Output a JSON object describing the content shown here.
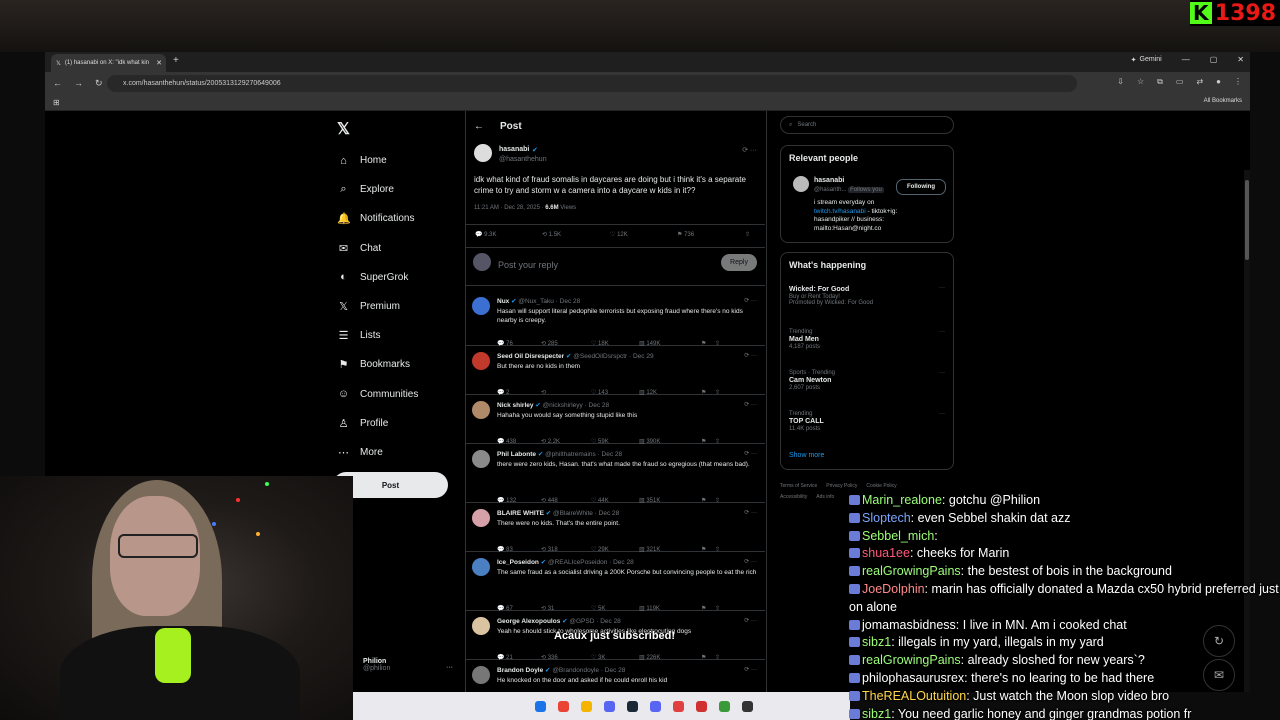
{
  "overlay": {
    "kick_logo": "K",
    "kick_count": "1398"
  },
  "browser": {
    "tab_title": "(1) hasanabi on X: \"idk what kin",
    "url": "x.com/hasanthehun/status/2005313129270649006",
    "gemini": "Gemini",
    "all_bookmarks": "All Bookmarks"
  },
  "x": {
    "nav": [
      {
        "label": "Home",
        "icon": "home-icon",
        "glyph": "⌂"
      },
      {
        "label": "Explore",
        "icon": "search-icon",
        "glyph": "⌕"
      },
      {
        "label": "Notifications",
        "icon": "bell-icon",
        "glyph": "🔔"
      },
      {
        "label": "Chat",
        "icon": "chat-icon",
        "glyph": "✉"
      },
      {
        "label": "SuperGrok",
        "icon": "grok-icon",
        "glyph": "◐"
      },
      {
        "label": "Premium",
        "icon": "x-logo-icon",
        "glyph": "𝕏"
      },
      {
        "label": "Lists",
        "icon": "list-icon",
        "glyph": "☰"
      },
      {
        "label": "Bookmarks",
        "icon": "bookmark-icon",
        "glyph": "⚑"
      },
      {
        "label": "Communities",
        "icon": "people-icon",
        "glyph": "☺"
      },
      {
        "label": "Profile",
        "icon": "person-icon",
        "glyph": "♙"
      },
      {
        "label": "More",
        "icon": "more-icon",
        "glyph": "⋯"
      }
    ],
    "post_button": "Post",
    "account": {
      "name": "Philion",
      "handle": "@philion"
    },
    "header": {
      "back": "←",
      "title": "Post"
    },
    "main_post": {
      "name": "hasanabi",
      "handle": "@hasanthehun",
      "text": "idk what kind of fraud somalis in daycares are doing but i think it's a separate crime to try and storm w a camera into a daycare w kids in it??",
      "time": "11:21 AM · Dec 28, 2025 · ",
      "views_num": "6.6M",
      "views_label": " Views",
      "replies": "9.3K",
      "reposts": "1.5K",
      "likes": "12K",
      "bookmarks": "736"
    },
    "reply_box": {
      "placeholder": "Post your reply",
      "button": "Reply"
    },
    "replies": [
      {
        "name": "Nux",
        "meta": "@Nux_Taku · Dec 28",
        "text": "Hasan will support literal pedophile terrorists but exposing fraud where there's no kids nearby is creepy.",
        "r": "76",
        "rt": "285",
        "l": "18K",
        "v": "149K",
        "color": "#3b6fd1"
      },
      {
        "name": "Seed Oil Disrespecter",
        "meta": "@SeedOilDsrspctr · Dec 29",
        "text": "But there are no kids in them",
        "r": "2",
        "rt": "",
        "l": "143",
        "v": "12K",
        "color": "#c0392b"
      },
      {
        "name": "Nick shirley",
        "meta": "@nickshirleyy · Dec 28",
        "text": "Hahaha you would say something stupid like this",
        "r": "438",
        "rt": "2.2K",
        "l": "59K",
        "v": "390K",
        "color": "#b08968"
      },
      {
        "name": "Phil Labonte",
        "meta": "@philthatremains · Dec 28",
        "text": "there were zero kids, Hasan. that's what made the fraud so egregious (that means bad).",
        "r": "132",
        "rt": "448",
        "l": "44K",
        "v": "351K",
        "color": "#8a8a8a"
      },
      {
        "name": "BLAIRE WHITE",
        "meta": "@BlaireWhite · Dec 28",
        "text": "There were no kids. That's the entire point.",
        "r": "83",
        "rt": "318",
        "l": "29K",
        "v": "321K",
        "color": "#d6a0a8"
      },
      {
        "name": "Ice_Poseidon",
        "meta": "@REALIcePoseidon · Dec 28",
        "text": "The same fraud as a socialist driving a 200K Porsche but convincing people to eat the rich",
        "r": "67",
        "rt": "31",
        "l": "5K",
        "v": "119K",
        "color": "#4a7fc1"
      },
      {
        "name": "George Alexopoulos",
        "meta": "@GPSD · Dec 28",
        "text": "Yeah he should stick to wholesome activities like electrocuting dogs",
        "r": "21",
        "rt": "336",
        "l": "3K",
        "v": "226K",
        "color": "#d9c3a0"
      },
      {
        "name": "Brandon Doyle",
        "meta": "@Brandondoyle · Dec 28",
        "text": "He knocked on the door and asked if he could enroll his kid",
        "r": "",
        "rt": "",
        "l": "",
        "v": "",
        "color": "#777"
      }
    ],
    "search_placeholder": "Search",
    "relevant": {
      "title": "Relevant people",
      "name": "hasanabi",
      "handle": "@hasanth...",
      "follows_you": "Follows you",
      "button": "Following",
      "bio_1": "i stream everyday on ",
      "bio_link": "twitch.tv/hasanabi",
      "bio_2": " - tiktok+ig: hasandpiker // business: mailto:Hasan@night.co"
    },
    "happening": {
      "title": "What's happening",
      "promo_title": "Wicked: For Good",
      "promo_sub": "Buy or Rent Today!",
      "promo_by": "Promoted by Wicked: For Good",
      "trends": [
        {
          "cat": "Trending",
          "name": "Mad Men",
          "posts": "4,187 posts"
        },
        {
          "cat": "Sports · Trending",
          "name": "Cam Newton",
          "posts": "2,607 posts"
        },
        {
          "cat": "Trending",
          "name": "TOP CALL",
          "posts": "11.4K posts"
        }
      ],
      "show_more": "Show more"
    },
    "footer": [
      "Terms of Service",
      "Privacy Policy",
      "Cookie Policy",
      "Accessibility",
      "Ads info"
    ]
  },
  "chat": [
    {
      "user": "Marin_realone",
      "color": "#9dff7a",
      "msg": ": gotchu @Philion"
    },
    {
      "user": "Sloptech",
      "color": "#7aa6ff",
      "msg": ": even Sebbel shakin dat azz"
    },
    {
      "user": "Sebbel_mich",
      "color": "#9dff7a",
      "msg": ": "
    },
    {
      "user": "shua1ee",
      "color": "#ff5a7a",
      "msg": ": cheeks for Marin"
    },
    {
      "user": "realGrowingPains",
      "color": "#9dff7a",
      "msg": ": the bestest of bois in the background"
    },
    {
      "user": "JoeDolphin",
      "color": "#ff8a8a",
      "msg": ": marin has officially donated a Mazda cx50 hybrid preferred just on alone"
    },
    {
      "user": "jomamasbidness",
      "color": "#ffffff",
      "msg": ": I live in MN. Am i cooked chat"
    },
    {
      "user": "sibz1",
      "color": "#9dff7a",
      "msg": ": illegals in my yard, illegals in my yard"
    },
    {
      "user": "realGrowingPains",
      "color": "#9dff7a",
      "msg": ": already sloshed for new years`?"
    },
    {
      "user": "philophasaurusrex",
      "color": "#ffffff",
      "msg": ": there's no learing to be had there"
    },
    {
      "user": "TheREALOutuition",
      "color": "#ffd84a",
      "msg": ": Just watch the Moon slop video bro"
    },
    {
      "user": "sibz1",
      "color": "#9dff7a",
      "msg": ": You need garlic honey and ginger grandmas potion fr"
    }
  ],
  "subscribe_text": "Acaux just subscribed!",
  "colors": {
    "accent": "#1d9bf0",
    "bg": "#000000",
    "border": "#2f3336"
  }
}
